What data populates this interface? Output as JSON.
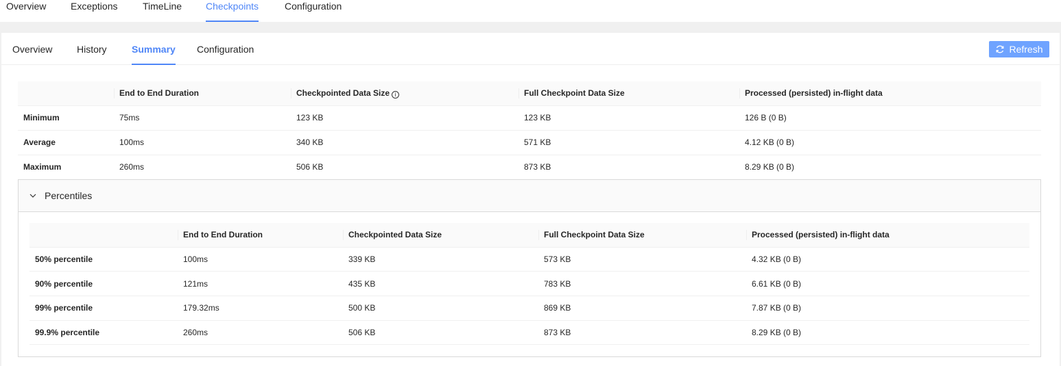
{
  "top_tabs": [
    "Overview",
    "Exceptions",
    "TimeLine",
    "Checkpoints",
    "Configuration"
  ],
  "sub_tabs": [
    "Overview",
    "History",
    "Summary",
    "Configuration"
  ],
  "refresh_label": "Refresh",
  "summary": {
    "headers": [
      "",
      "End to End Duration",
      "Checkpointed Data Size",
      "Full Checkpoint Data Size",
      "Processed (persisted) in-flight data"
    ],
    "rows": [
      [
        "Minimum",
        "75ms",
        "123 KB",
        "123 KB",
        "126 B (0 B)"
      ],
      [
        "Average",
        "100ms",
        "340 KB",
        "571 KB",
        "4.12 KB (0 B)"
      ],
      [
        "Maximum",
        "260ms",
        "506 KB",
        "873 KB",
        "8.29 KB (0 B)"
      ]
    ]
  },
  "percentiles": {
    "title": "Percentiles",
    "headers": [
      "",
      "End to End Duration",
      "Checkpointed Data Size",
      "Full Checkpoint Data Size",
      "Processed (persisted) in-flight data"
    ],
    "rows": [
      [
        "50% percentile",
        "100ms",
        "339 KB",
        "573 KB",
        "4.32 KB (0 B)"
      ],
      [
        "90% percentile",
        "121ms",
        "435 KB",
        "783 KB",
        "6.61 KB (0 B)"
      ],
      [
        "99% percentile",
        "179.32ms",
        "500 KB",
        "869 KB",
        "7.87 KB (0 B)"
      ],
      [
        "99.9% percentile",
        "260ms",
        "506 KB",
        "873 KB",
        "8.29 KB (0 B)"
      ]
    ]
  }
}
